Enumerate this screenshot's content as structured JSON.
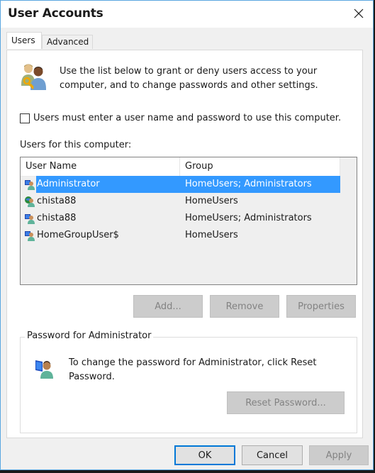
{
  "window": {
    "title": "User Accounts",
    "close_icon": "close-icon"
  },
  "tabs": [
    {
      "label": "Users",
      "active": true
    },
    {
      "label": "Advanced",
      "active": false
    }
  ],
  "intro": {
    "icon": "users-key-icon",
    "text": "Use the list below to grant or deny users access to your computer, and to change passwords and other settings."
  },
  "require_login": {
    "label": "Users must enter a user name and password to use this computer.",
    "checked": false
  },
  "users_list": {
    "label": "Users for this computer:",
    "columns": [
      "User Name",
      "Group"
    ],
    "rows": [
      {
        "name": "Administrator",
        "group": "HomeUsers; Administrators",
        "icon": "local-user-icon",
        "selected": true
      },
      {
        "name": "chista88",
        "group": "HomeUsers",
        "icon": "microsoft-account-user-icon",
        "selected": false
      },
      {
        "name": "chista88",
        "group": "HomeUsers; Administrators",
        "icon": "local-user-icon",
        "selected": false
      },
      {
        "name": "HomeGroupUser$",
        "group": "HomeUsers",
        "icon": "local-user-icon",
        "selected": false
      }
    ],
    "selection_color": "#3399ff"
  },
  "list_buttons": {
    "add": "Add...",
    "remove": "Remove",
    "properties": "Properties"
  },
  "password_group": {
    "title": "Password for Administrator",
    "icon": "user-computer-icon",
    "text": "To change the password for Administrator, click Reset Password.",
    "reset_button": "Reset Password..."
  },
  "footer": {
    "ok": "OK",
    "cancel": "Cancel",
    "apply": "Apply"
  }
}
